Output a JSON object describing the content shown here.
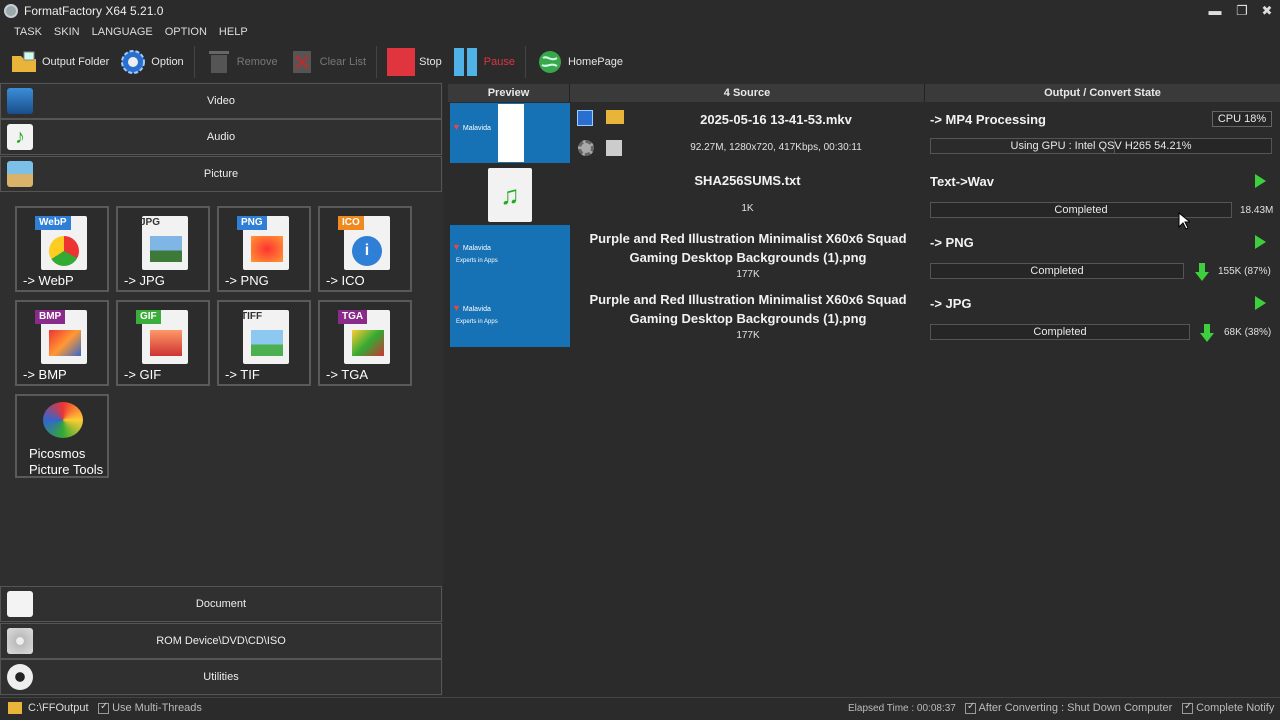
{
  "window": {
    "title": "FormatFactory X64 5.21.0",
    "min": "▬",
    "max": "❐",
    "close": "✖"
  },
  "menu": [
    "TASK",
    "SKIN",
    "LANGUAGE",
    "OPTION",
    "HELP"
  ],
  "toolbar": {
    "output_folder": "Output Folder",
    "option": "Option",
    "remove": "Remove",
    "clear_list": "Clear List",
    "stop": "Stop",
    "pause": "Pause",
    "homepage": "HomePage"
  },
  "categories": {
    "video": "Video",
    "audio": "Audio",
    "picture": "Picture",
    "document": "Document",
    "rom": "ROM Device\\DVD\\CD\\ISO",
    "utilities": "Utilities"
  },
  "tiles": [
    {
      "badge": "WebP",
      "label": "-> WebP",
      "color": "#2f7fd6"
    },
    {
      "badge": "JPG",
      "label": "-> JPG",
      "color": "#f2f2f2"
    },
    {
      "badge": "PNG",
      "label": "-> PNG",
      "color": "#2f7fd6"
    },
    {
      "badge": "ICO",
      "label": "-> ICO",
      "color": "#f08a1e"
    },
    {
      "badge": "BMP",
      "label": "-> BMP",
      "color": "#8a2a8a"
    },
    {
      "badge": "GIF",
      "label": "-> GIF",
      "color": "#3aae3a"
    },
    {
      "badge": "TIFF",
      "label": "-> TIF",
      "color": "#f2f2f2"
    },
    {
      "badge": "TGA",
      "label": "-> TGA",
      "color": "#8a2a8a"
    }
  ],
  "picosmos": {
    "line1": "Picosmos",
    "line2": "Picture Tools"
  },
  "table": {
    "col_preview": "Preview",
    "col_source": "4 Source",
    "col_output": "Output / Convert State"
  },
  "malavida": {
    "name": "Malavida",
    "tag": "Experts in Apps"
  },
  "tasks": [
    {
      "name": "2025-05-16 13-41-53.mkv",
      "info": "92.27M, 1280x720, 417Kbps, 00:30:11",
      "state": "-> MP4 Processing",
      "progress_text": "Using GPU : Intel QSV H265 54.21%",
      "progress": 0.5421,
      "cpu": "CPU 18%"
    },
    {
      "name": "SHA256SUMS.txt",
      "info": "1K",
      "state": "Text->Wav",
      "progress_text": "Completed",
      "size": "18.43M"
    },
    {
      "name": "Purple and Red Illustration Minimalist X60x6 Squad Gaming Desktop Backgrounds (1).png",
      "info": "177K",
      "state": "-> PNG",
      "progress_text": "Completed",
      "size": "155K (87%)"
    },
    {
      "name": "Purple and Red Illustration Minimalist X60x6 Squad Gaming Desktop Backgrounds (1).png",
      "info": "177K",
      "state": "-> JPG",
      "progress_text": "Completed",
      "size": "68K (38%)"
    }
  ],
  "status": {
    "output": "C:\\FFOutput",
    "multi": "Use Multi-Threads",
    "elapsed": "Elapsed Time : 00:08:37",
    "after": "After Converting : Shut Down Computer",
    "notify": "Complete Notify"
  }
}
